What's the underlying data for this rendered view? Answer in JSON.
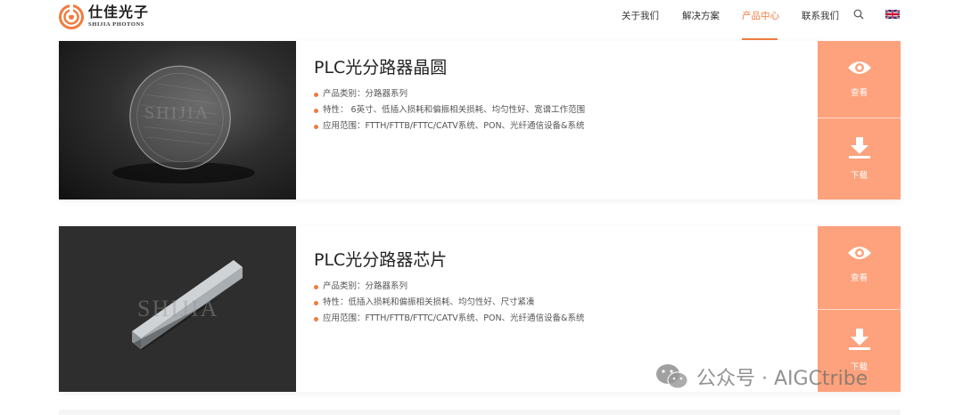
{
  "header": {
    "logo": {
      "cn": "仕佳光子",
      "en": "SHIJIA PHOTONS"
    },
    "nav": [
      {
        "label": "关于我们",
        "active": false
      },
      {
        "label": "解决方案",
        "active": false
      },
      {
        "label": "产品中心",
        "active": true
      },
      {
        "label": "联系我们",
        "active": false
      }
    ],
    "icons": {
      "search": "search-icon",
      "language": "uk-flag-icon"
    }
  },
  "products": [
    {
      "title": "PLC光分路器晶圆",
      "image_watermark": "SHIJIA",
      "bullets": [
        "产品类别：分路器系列",
        "特性：  6英寸、低插入损耗和偏振相关损耗、均匀性好、宽谱工作范围",
        "应用范围：FTTH/FTTB/FTTC/CATV系统、PON、光纤通信设备&系统"
      ],
      "actions": {
        "view": "查看",
        "download": "下载"
      }
    },
    {
      "title": "PLC光分路器芯片",
      "image_watermark": "SHIJIA",
      "bullets": [
        "产品类别：分路器系列",
        "特性：低插入损耗和偏振相关损耗、均匀性好、尺寸紧凑",
        "应用范围：FTTH/FTTB/FTTC/CATV系统、PON、光纤通信设备&系统"
      ],
      "actions": {
        "view": "查看",
        "download": "下载"
      }
    }
  ],
  "overlay_watermark": "公众号 · AIGCtribe",
  "colors": {
    "accent": "#f07c3f",
    "button": "#fda27c",
    "text": "#333333"
  }
}
